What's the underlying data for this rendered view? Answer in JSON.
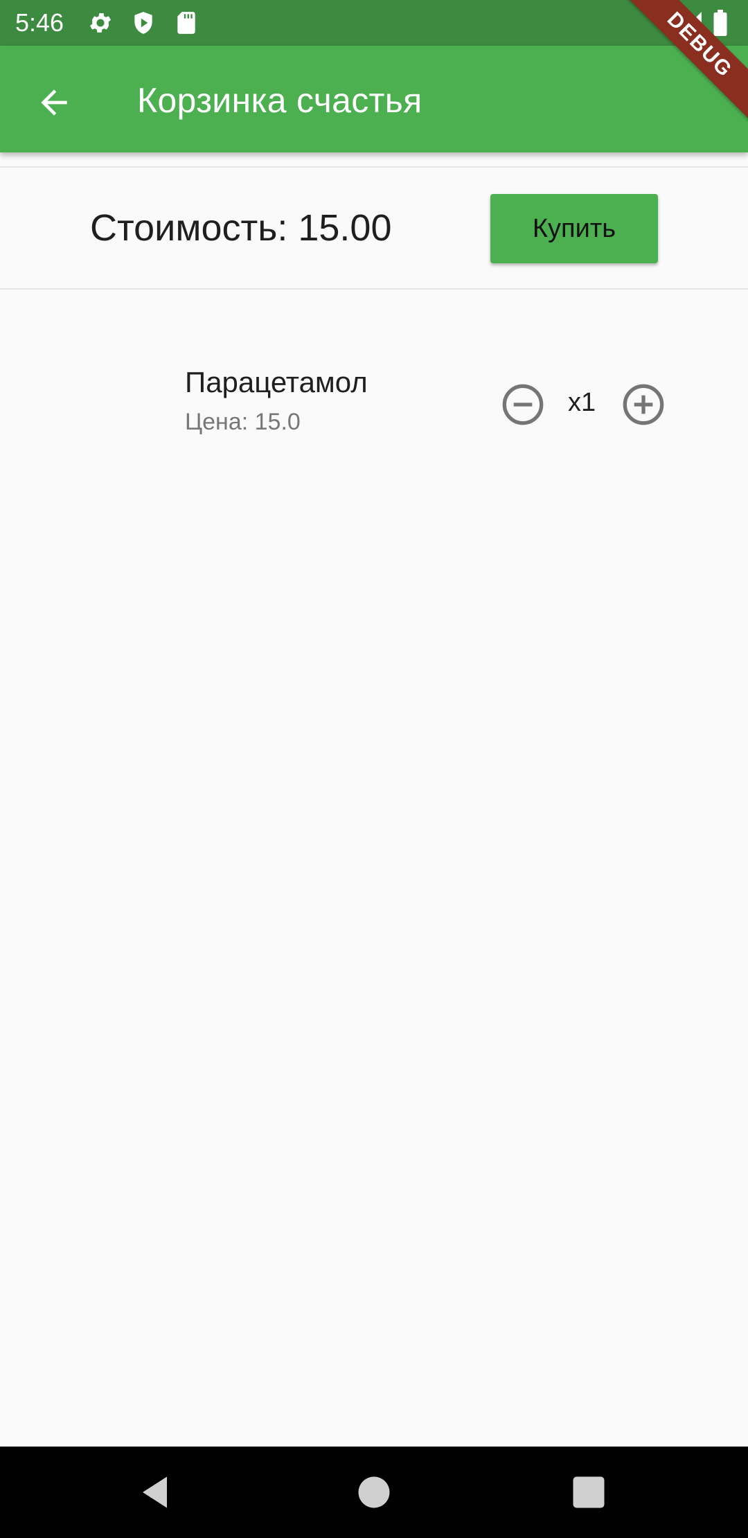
{
  "status_bar": {
    "time": "5:46",
    "icons": [
      "gear-icon",
      "shield-play-icon",
      "sd-card-icon",
      "wifi-off-icon",
      "signal-icon",
      "battery-icon"
    ]
  },
  "app_bar": {
    "title": "Корзинка счастья",
    "back_icon": "arrow-back-icon"
  },
  "debug_banner": "DEBUG",
  "summary": {
    "cost_label": "Стоимость: 15.00",
    "buy_label": "Купить"
  },
  "cart": {
    "items": [
      {
        "name": "Парацетамол",
        "price": "Цена: 15.0",
        "quantity": "x1"
      }
    ]
  },
  "nav_bar": {
    "icons": [
      "back-triangle-icon",
      "home-circle-icon",
      "recents-square-icon"
    ]
  },
  "colors": {
    "primary": "#4caf50",
    "status_bar": "#3d8b40",
    "debug": "#8a2f1f"
  }
}
